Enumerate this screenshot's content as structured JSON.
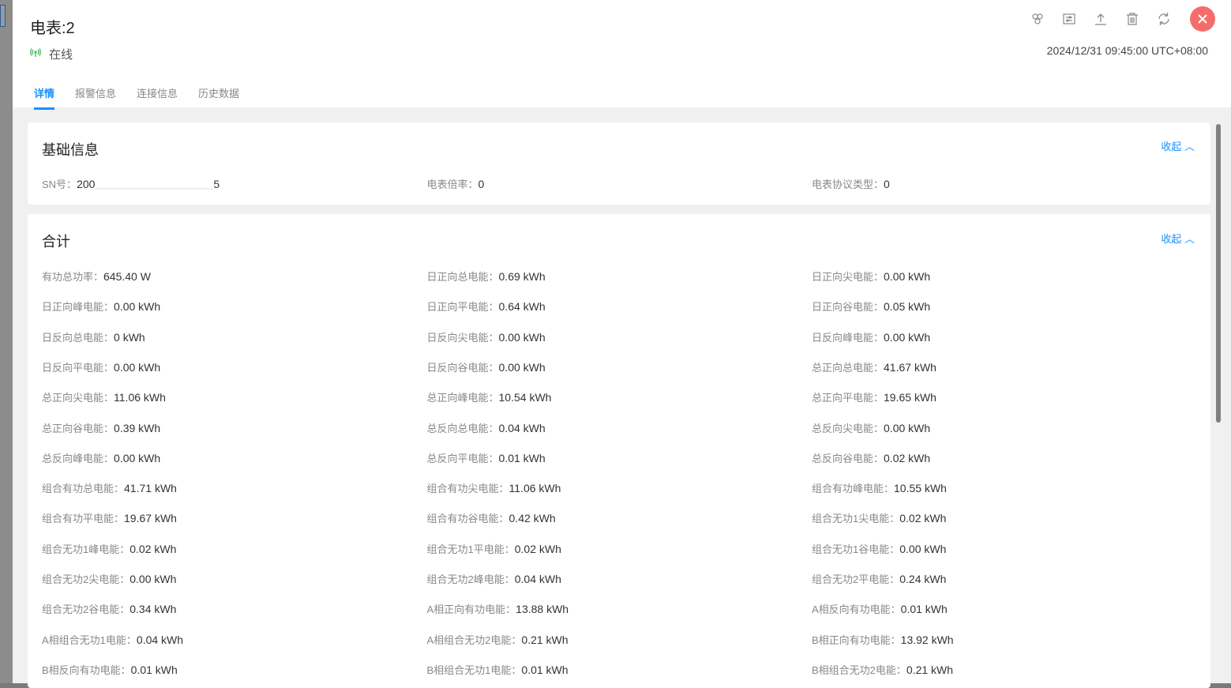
{
  "header": {
    "title": "电表:2",
    "status": "在线",
    "time": "2024/12/31 09:45:00 UTC+08:00"
  },
  "tabs": [
    "详情",
    "报警信息",
    "连接信息",
    "历史数据"
  ],
  "basic": {
    "title": "基础信息",
    "collapse": "收起",
    "sn_label": "SN号：",
    "sn_prefix": "200",
    "sn_suffix": "5",
    "items": [
      {
        "label": "电表倍率：",
        "value": "0"
      },
      {
        "label": "电表协议类型：",
        "value": "0"
      }
    ]
  },
  "total": {
    "title": "合计",
    "collapse": "收起",
    "items": [
      {
        "label": "有功总功率：",
        "value": "645.40 W"
      },
      {
        "label": "日正向总电能：",
        "value": "0.69 kWh"
      },
      {
        "label": "日正向尖电能：",
        "value": "0.00 kWh"
      },
      {
        "label": "日正向峰电能：",
        "value": "0.00 kWh"
      },
      {
        "label": "日正向平电能：",
        "value": "0.64 kWh"
      },
      {
        "label": "日正向谷电能：",
        "value": "0.05 kWh"
      },
      {
        "label": "日反向总电能：",
        "value": "0 kWh"
      },
      {
        "label": "日反向尖电能：",
        "value": "0.00 kWh"
      },
      {
        "label": "日反向峰电能：",
        "value": "0.00 kWh"
      },
      {
        "label": "日反向平电能：",
        "value": "0.00 kWh"
      },
      {
        "label": "日反向谷电能：",
        "value": "0.00 kWh"
      },
      {
        "label": "总正向总电能：",
        "value": "41.67 kWh"
      },
      {
        "label": "总正向尖电能：",
        "value": "11.06 kWh"
      },
      {
        "label": "总正向峰电能：",
        "value": "10.54 kWh"
      },
      {
        "label": "总正向平电能：",
        "value": "19.65 kWh"
      },
      {
        "label": "总正向谷电能：",
        "value": "0.39 kWh"
      },
      {
        "label": "总反向总电能：",
        "value": "0.04 kWh"
      },
      {
        "label": "总反向尖电能：",
        "value": "0.00 kWh"
      },
      {
        "label": "总反向峰电能：",
        "value": "0.00 kWh"
      },
      {
        "label": "总反向平电能：",
        "value": "0.01 kWh"
      },
      {
        "label": "总反向谷电能：",
        "value": "0.02 kWh"
      },
      {
        "label": "组合有功总电能：",
        "value": "41.71 kWh"
      },
      {
        "label": "组合有功尖电能：",
        "value": "11.06 kWh"
      },
      {
        "label": "组合有功峰电能：",
        "value": "10.55 kWh"
      },
      {
        "label": "组合有功平电能：",
        "value": "19.67 kWh"
      },
      {
        "label": "组合有功谷电能：",
        "value": "0.42 kWh"
      },
      {
        "label": "组合无功1尖电能：",
        "value": "0.02 kWh"
      },
      {
        "label": "组合无功1峰电能：",
        "value": "0.02 kWh"
      },
      {
        "label": "组合无功1平电能：",
        "value": "0.02 kWh"
      },
      {
        "label": "组合无功1谷电能：",
        "value": "0.00 kWh"
      },
      {
        "label": "组合无功2尖电能：",
        "value": "0.00 kWh"
      },
      {
        "label": "组合无功2峰电能：",
        "value": "0.04 kWh"
      },
      {
        "label": "组合无功2平电能：",
        "value": "0.24 kWh"
      },
      {
        "label": "组合无功2谷电能：",
        "value": "0.34 kWh"
      },
      {
        "label": "A相正向有功电能：",
        "value": "13.88 kWh"
      },
      {
        "label": "A相反向有功电能：",
        "value": "0.01 kWh"
      },
      {
        "label": "A相组合无功1电能：",
        "value": "0.04 kWh"
      },
      {
        "label": "A相组合无功2电能：",
        "value": "0.21 kWh"
      },
      {
        "label": "B相正向有功电能：",
        "value": "13.92 kWh"
      },
      {
        "label": "B相反向有功电能：",
        "value": "0.01 kWh"
      },
      {
        "label": "B相组合无功1电能：",
        "value": "0.01 kWh"
      },
      {
        "label": "B相组合无功2电能：",
        "value": "0.21 kWh"
      }
    ]
  }
}
